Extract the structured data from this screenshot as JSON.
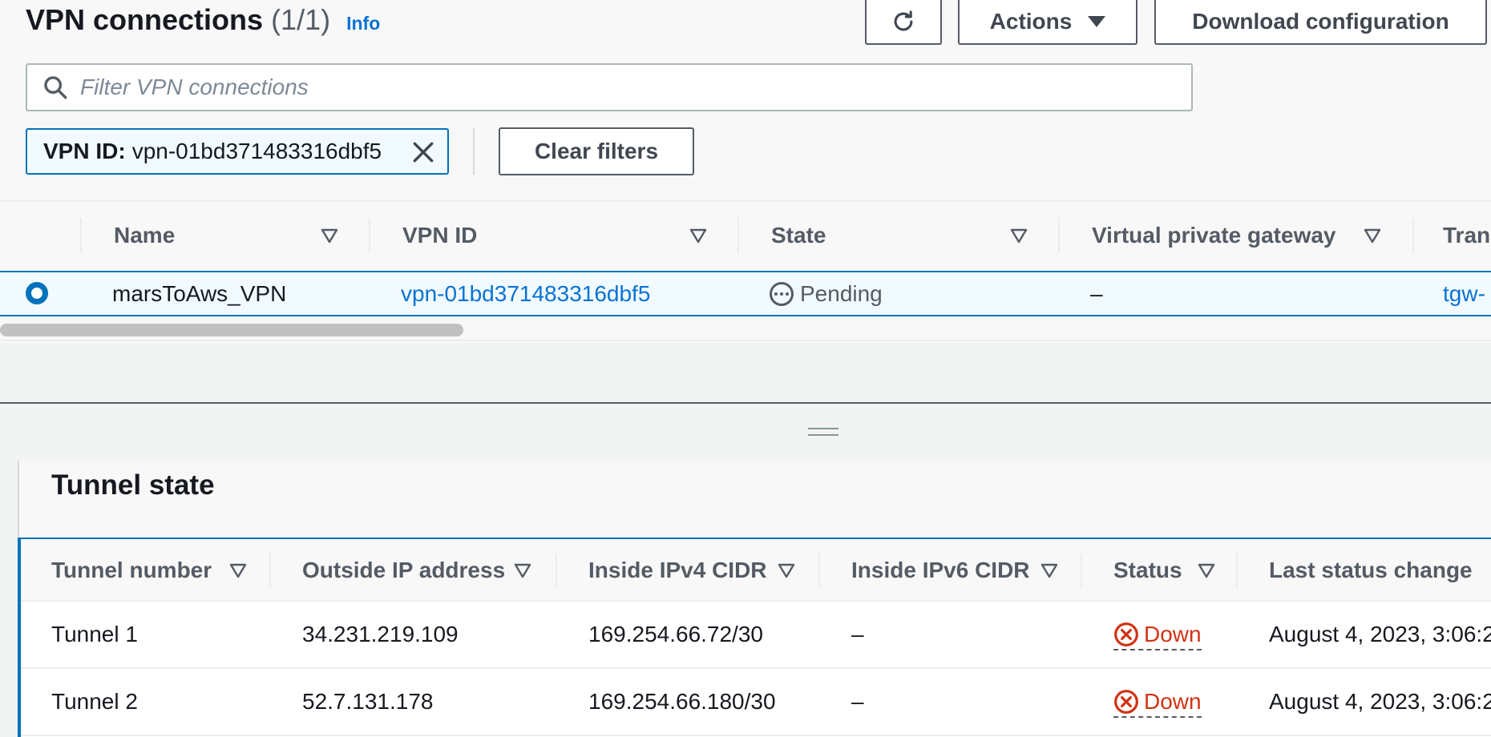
{
  "header": {
    "title": "VPN connections",
    "count": "(1/1)",
    "info": "Info",
    "actions_label": "Actions",
    "download_label": "Download configuration",
    "search_placeholder": "Filter VPN connections",
    "filter_token_key": "VPN ID:",
    "filter_token_value": "vpn-01bd371483316dbf5",
    "clear_filters_label": "Clear filters"
  },
  "vpn_table": {
    "columns": [
      "Name",
      "VPN ID",
      "State",
      "Virtual private gateway",
      "Tran"
    ],
    "rows": [
      {
        "name": "marsToAws_VPN",
        "vpn_id": "vpn-01bd371483316dbf5",
        "state": "Pending",
        "virtual_private_gateway": "–",
        "transit_gateway": "tgw-",
        "selected": true
      }
    ]
  },
  "tunnel_state": {
    "title": "Tunnel state",
    "columns": [
      "Tunnel number",
      "Outside IP address",
      "Inside IPv4 CIDR",
      "Inside IPv6 CIDR",
      "Status",
      "Last status change"
    ],
    "rows": [
      {
        "tunnel_number": "Tunnel 1",
        "outside_ip": "34.231.219.109",
        "inside_ipv4": "169.254.66.72/30",
        "inside_ipv6": "–",
        "status": "Down",
        "last_status_change": "August 4, 2023, 3:06:2"
      },
      {
        "tunnel_number": "Tunnel 2",
        "outside_ip": "52.7.131.178",
        "inside_ipv4": "169.254.66.180/30",
        "inside_ipv6": "–",
        "status": "Down",
        "last_status_change": "August 4, 2023, 3:06:2"
      }
    ]
  },
  "colors": {
    "link": "#0972d3",
    "selected_border": "#0073bb",
    "selected_bg": "#f1faff",
    "error": "#d13212"
  },
  "icons": [
    "refresh-icon",
    "caret-down-icon",
    "search-icon",
    "close-icon",
    "sort-icon",
    "pending-icon",
    "error-icon",
    "drag-handle-icon"
  ]
}
